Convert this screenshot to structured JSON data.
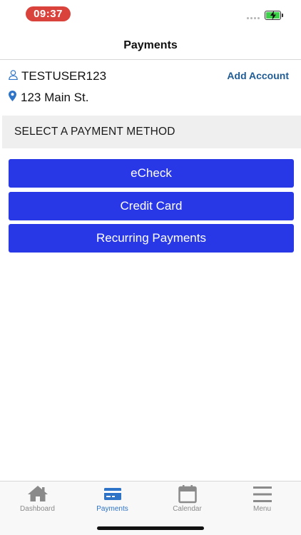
{
  "status_bar": {
    "time": "09:37",
    "time_pill_color": "#d9433c",
    "battery_color": "#3ed04a"
  },
  "header": {
    "title": "Payments"
  },
  "account": {
    "user_icon": "user-icon",
    "username": "TESTUSER123",
    "add_account_label": "Add Account",
    "location_icon": "map-pin-icon",
    "address": "123 Main St."
  },
  "payment_section": {
    "title": "SELECT A PAYMENT METHOD",
    "buttons": [
      {
        "label": "eCheck"
      },
      {
        "label": "Credit Card"
      },
      {
        "label": "Recurring Payments"
      }
    ],
    "button_color": "#2838e6"
  },
  "tab_bar": {
    "active_color": "#2d73c7",
    "inactive_color": "#8a8a8a",
    "tabs": [
      {
        "label": "Dashboard",
        "icon": "home-icon",
        "active": false
      },
      {
        "label": "Payments",
        "icon": "credit-card-icon",
        "active": true
      },
      {
        "label": "Calendar",
        "icon": "calendar-icon",
        "active": false
      },
      {
        "label": "Menu",
        "icon": "hamburger-menu-icon",
        "active": false
      }
    ]
  }
}
